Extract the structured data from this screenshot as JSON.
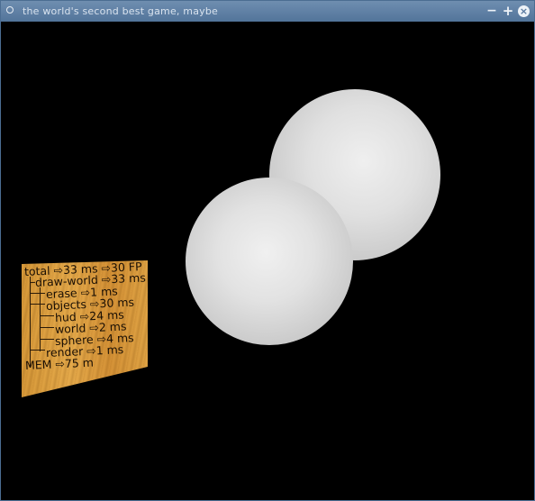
{
  "window": {
    "title": "the world's second best game, maybe",
    "buttons": {
      "minimize": "−",
      "maximize": "+",
      "close": "×"
    }
  },
  "hud": {
    "lines": [
      "total ⇨33 ms ⇨30 FP",
      "draw-world ⇨33 ms",
      "erase ⇨1 ms",
      "objects ⇨30 ms",
      "hud ⇨24 ms",
      "world ⇨2 ms",
      "sphere ⇨4 ms",
      "render ⇨1 ms",
      "MEM ⇨75 m"
    ]
  },
  "scene": {
    "objects": [
      "sphere",
      "sphere"
    ],
    "colors": {
      "background": "#000000",
      "sphere": "#e0e0e0",
      "hud_panel": "#e0a445"
    }
  }
}
